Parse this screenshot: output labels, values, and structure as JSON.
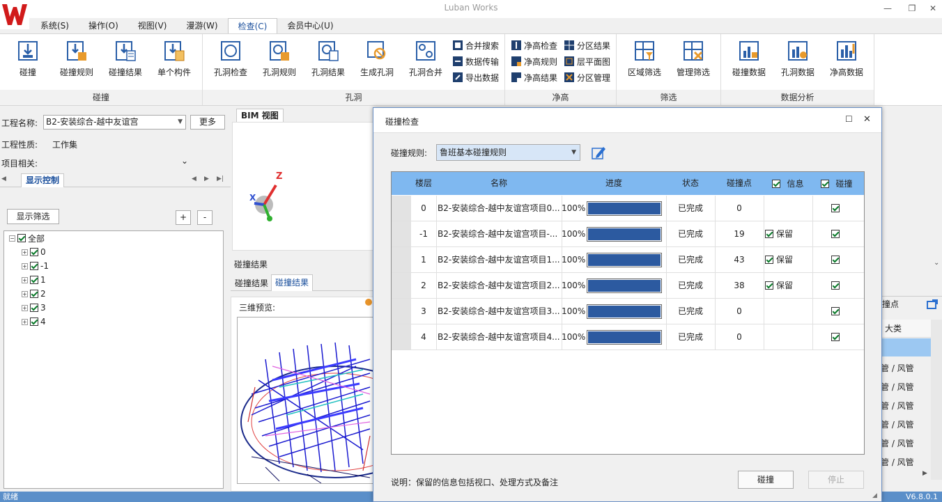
{
  "app": {
    "title": "Luban Works",
    "version": "V6.8.0.1",
    "status": "就绪"
  },
  "menu": [
    "系统(S)",
    "操作(O)",
    "视图(V)",
    "漫游(W)",
    "检查(C)",
    "会员中心(U)"
  ],
  "ribbon": {
    "groups": [
      "碰撞",
      "孔洞",
      "净高",
      "筛选",
      "数据分析"
    ],
    "collision": [
      "碰撞",
      "碰撞规则",
      "碰撞结果",
      "单个构件"
    ],
    "hole": [
      "孔洞检查",
      "孔洞规则",
      "孔洞结果",
      "生成孔洞",
      "孔洞合并"
    ],
    "hole_small": [
      "合并搜索",
      "数据传输",
      "导出数据"
    ],
    "clear_small": [
      "净高检查",
      "净高规则",
      "净高结果"
    ],
    "clear_small2": [
      "分区结果",
      "层平面图",
      "分区管理"
    ],
    "filter": [
      "区域筛选",
      "管理筛选"
    ],
    "analysis": [
      "碰撞数据",
      "孔洞数据",
      "净高数据"
    ]
  },
  "left": {
    "project_label": "工程名称:",
    "project_value": "B2-安装综合-越中友谊宫",
    "more_button": "更多",
    "nature_label": "工程性质:",
    "nature_value": "工作集",
    "related_label": "项目相关:",
    "tab": "显示控制",
    "filter_button": "显示筛选",
    "plus": "+",
    "minus": "-",
    "tree_root": "全部",
    "tree_items": [
      "0",
      "-1",
      "1",
      "2",
      "3",
      "4"
    ]
  },
  "bim": {
    "tab": "BIM 视图",
    "axis_z": "Z",
    "axis_x": "X"
  },
  "results": {
    "title": "碰撞结果",
    "tabs": [
      "碰撞结果",
      "碰撞结果"
    ],
    "preview_label": "三维预览:"
  },
  "right_strip": {
    "header": "撞点",
    "col": "大类",
    "rows": [
      "管 / 风管",
      "管 / 风管",
      "管 / 风管",
      "管 / 风管",
      "管 / 风管",
      "管 / 风管"
    ]
  },
  "dialog": {
    "title": "碰撞检查",
    "rule_label": "碰撞规则:",
    "rule_value": "鲁班基本碰撞规则",
    "columns": [
      "楼层",
      "名称",
      "进度",
      "状态",
      "碰撞点",
      "信息",
      "碰撞"
    ],
    "rows": [
      {
        "floor": "0",
        "name": "B2-安装综合-越中友谊宫项目0...",
        "percent": "100%",
        "progress": 1.0,
        "status": "已完成",
        "points": "0",
        "info": "",
        "collide": true
      },
      {
        "floor": "-1",
        "name": "B2-安装综合-越中友谊宫项目-...",
        "percent": "100%",
        "progress": 1.0,
        "status": "已完成",
        "points": "19",
        "info": "保留",
        "collide": true
      },
      {
        "floor": "1",
        "name": "B2-安装综合-越中友谊宫项目1...",
        "percent": "100%",
        "progress": 1.0,
        "status": "已完成",
        "points": "43",
        "info": "保留",
        "collide": true
      },
      {
        "floor": "2",
        "name": "B2-安装综合-越中友谊宫项目2...",
        "percent": "100%",
        "progress": 1.0,
        "status": "已完成",
        "points": "38",
        "info": "保留",
        "collide": true
      },
      {
        "floor": "3",
        "name": "B2-安装综合-越中友谊宫项目3...",
        "percent": "100%",
        "progress": 1.0,
        "status": "已完成",
        "points": "0",
        "info": "",
        "collide": true
      },
      {
        "floor": "4",
        "name": "B2-安装综合-越中友谊宫项目4...",
        "percent": "100%",
        "progress": 1.0,
        "status": "已完成",
        "points": "0",
        "info": "",
        "collide": true
      }
    ],
    "note": "说明：保留的信息包括视口、处理方式及备注",
    "collide_button": "碰撞",
    "stop_button": "停止"
  },
  "colors": {
    "accent": "#1a4f9c",
    "header": "#7fb8f0",
    "progress": "#2c5aa0",
    "status_bar": "#5b8fc9"
  }
}
